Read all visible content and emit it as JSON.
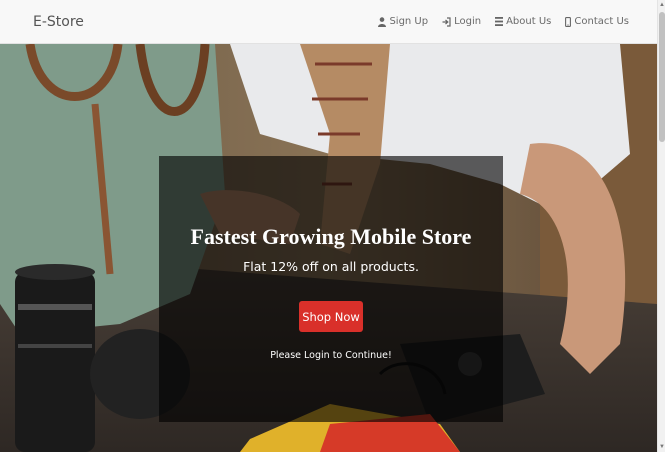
{
  "navbar": {
    "brand": "E-Store",
    "links": [
      {
        "label": "Sign Up",
        "icon": "user-icon"
      },
      {
        "label": "Login",
        "icon": "login-icon"
      },
      {
        "label": "About Us",
        "icon": "list-icon"
      },
      {
        "label": "Contact Us",
        "icon": "phone-icon"
      }
    ]
  },
  "hero": {
    "headline": "Fastest Growing Mobile Store",
    "subtitle": "Flat 12% off on all products.",
    "button_label": "Shop Now",
    "note": "Please Login to Continue!"
  },
  "colors": {
    "accent": "#d9302a",
    "navbar_bg": "#f8f8f8",
    "overlay": "rgba(0,0,0,0.62)"
  }
}
